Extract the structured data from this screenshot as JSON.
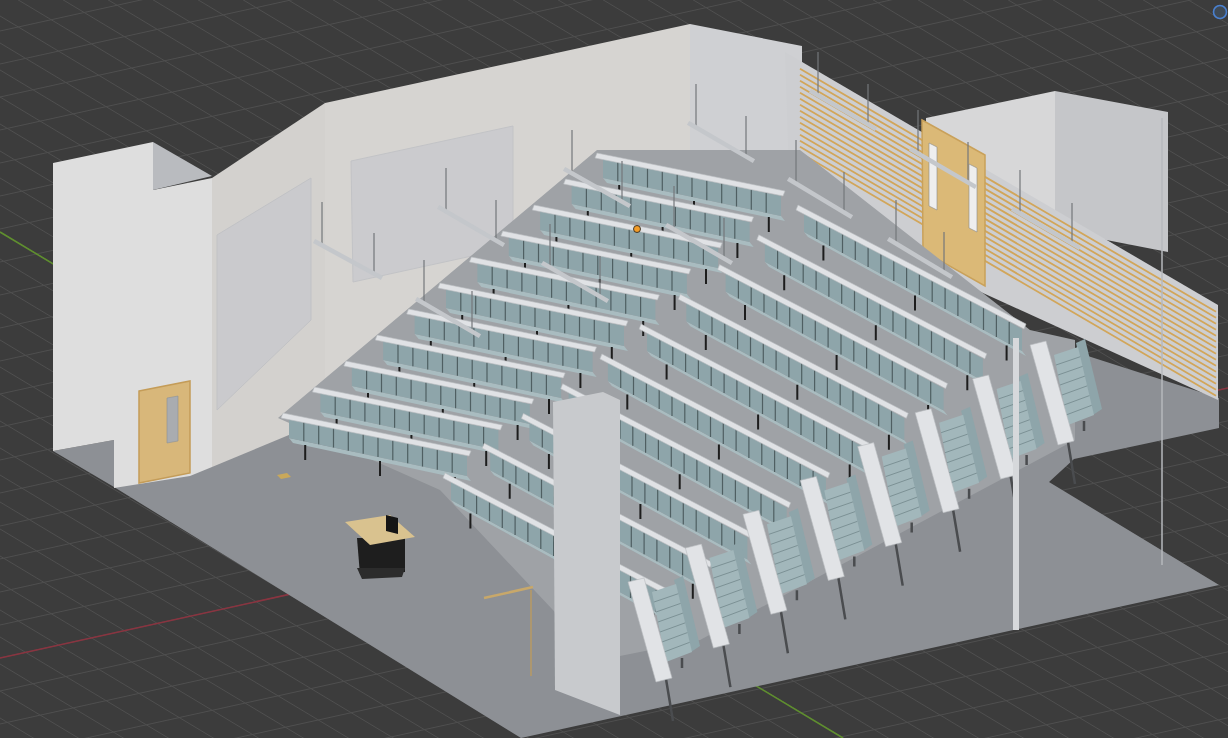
{
  "viewport": {
    "grid": true,
    "axis_lines": true,
    "origin_marker": true,
    "gizmo_handle": true
  }
}
